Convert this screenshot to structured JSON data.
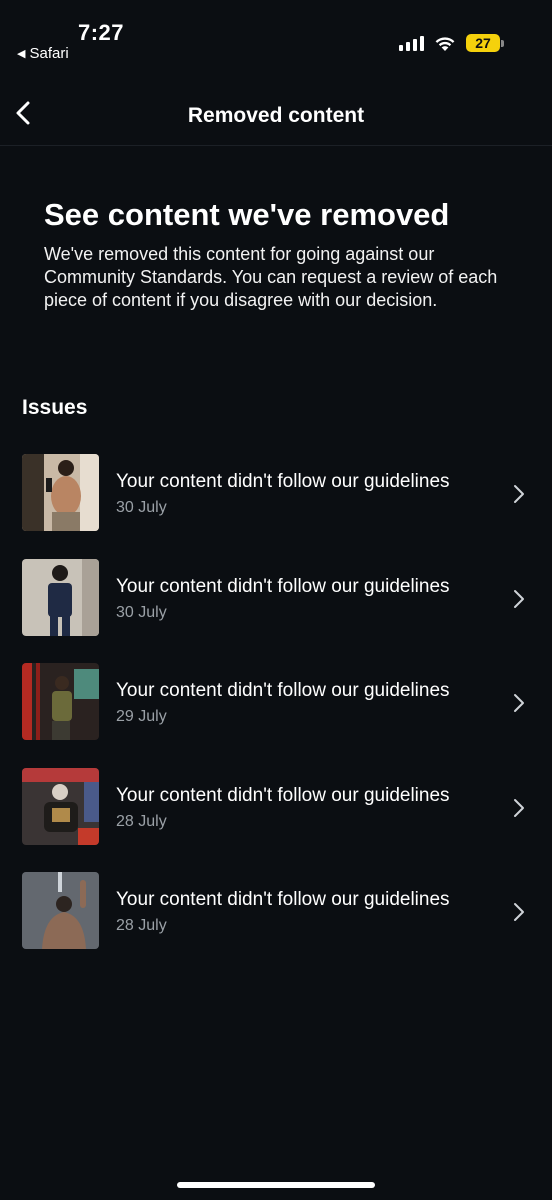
{
  "status_bar": {
    "time": "7:27",
    "back_app": "Safari",
    "battery": "27",
    "battery_color": "#f5d10c",
    "icons": [
      "signal-icon",
      "wifi-icon",
      "battery-icon"
    ]
  },
  "header": {
    "title": "Removed content",
    "back_icon": "chevron-left-icon"
  },
  "intro": {
    "heading": "See content we've removed",
    "body": "We've removed this content for going against our Community Standards. You can request a review of each piece of content if you disagree with our decision."
  },
  "issues": {
    "heading": "Issues",
    "items": [
      {
        "title": "Your content didn't follow our guidelines",
        "date": "30 July"
      },
      {
        "title": "Your content didn't follow our guidelines",
        "date": "30 July"
      },
      {
        "title": "Your content didn't follow our guidelines",
        "date": "29 July"
      },
      {
        "title": "Your content didn't follow our guidelines",
        "date": "28 July"
      },
      {
        "title": "Your content didn't follow our guidelines",
        "date": "28 July"
      }
    ]
  },
  "colors": {
    "background": "#0b0e12",
    "text": "#ffffff",
    "secondary_text": "#9aa0a6"
  }
}
